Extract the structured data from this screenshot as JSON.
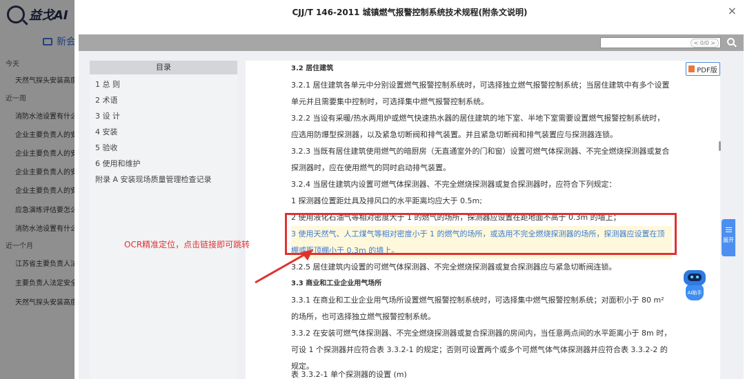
{
  "app": {
    "logo_text": "益戈AI",
    "new_chat_label": "新会",
    "groups": [
      {
        "label": "今天",
        "items": [
          "天然气探头安装高度"
        ]
      },
      {
        "label": "近一周",
        "items": [
          "消防水池设置有什么",
          "企业主要负责人的安",
          "企业主要负责人的安",
          "企业主要负责人的安",
          "企业主要负责人的安",
          "应急演练评估要怎么",
          "消防水池设置有什么"
        ]
      },
      {
        "label": "近一个月",
        "items": [
          "江苏省主要负责人法",
          "主要负责人法定安全",
          "天然气探头安装高度"
        ]
      }
    ]
  },
  "modal": {
    "title": "CJJ/T 146-2011 城镇燃气报警控制系统技术规程(附条文说明)",
    "close_label": "×"
  },
  "search": {
    "placeholder": "",
    "count": "< 0/0 >"
  },
  "toc": {
    "header": "目录",
    "items": [
      "1 总 则",
      "2 术语",
      "3 设 计",
      "4 安装",
      "5 验收",
      "6 使用和维护",
      "附录 A 安装现场质量管理检查记录"
    ]
  },
  "doc": {
    "pdf_label": "PDF版",
    "paragraphs": [
      {
        "text": "3.2 居住建筑",
        "style": "bold"
      },
      {
        "text": "3.2.1 居住建筑各单元中分别设置燃气报警控制系统时，可选择独立燃气报警控制系统；当居住建筑中有多个设置单元并且需要集中控制时，可选择集中燃气报警控制系统。",
        "style": "normal"
      },
      {
        "text": "3.2.2 当设有采暖/热水两用炉或燃气快速热水器的居住建筑的地下室、半地下室需要设置燃气报警控制系统时，应选用防爆型探测器，以及紧急切断阀和排气装置。并且紧急切断阀和排气装置应与探测器连锁。",
        "style": "normal"
      },
      {
        "text": "3.2.3 当既有居住建筑使用燃气的暗厨房（无直通室外的门和窗）设置可燃气体探测器、不完全燃烧探测器或复合探测器时，应在使用燃气的同时启动排气装置。",
        "style": "normal"
      },
      {
        "text": "3.2.4 当居住建筑内设置可燃气体探测器、不完全燃烧探测器或复合探测器时，应符合下列规定：",
        "style": "normal"
      },
      {
        "text": "1 探测器位置距灶具及排风口的水平距离均应大于 0.5m;",
        "style": "normal"
      },
      {
        "text": "2 使用液化石油气等相对密度大于 1 的燃气的场所，探测器应设置在距地面不高于 0.3m 的墙上；",
        "style": "normal"
      },
      {
        "text": "3 使用天然气、人工煤气等相对密度小于 1 的燃气的场所，或选用不完全燃烧探测器的场所，探测器应设置在顶棚或距顶棚小于 0.3m 的墙上。",
        "style": "highlight"
      },
      {
        "text": "3.2.5 居住建筑内设置的可燃气体探测器、不完全燃烧探测器或复合探测器应与紧急切断阀连锁。",
        "style": "normal"
      },
      {
        "text": "3.3 商业和工业企业用气场所",
        "style": "bold"
      },
      {
        "text": "3.3.1 在商业和工业企业用气场所设置燃气报警控制系统时，可选择集中燃气报警控制系统；对面积小于 80 m² 的场所，也可选择独立燃气报警控制系统。",
        "style": "normal"
      },
      {
        "text": "3.3.2 在安装可燃气体探测器、不完全燃烧探测器或复合探测器的房间内，当任意两点间的水平距离小于 8m 时，可设 1 个探测器并应符合表 3.3.2-1 的规定；否则可设置两个或多个可燃气体气体探测器并应符合表 3.3.2-2 的规定。",
        "style": "normal"
      },
      {
        "text": "表 3.3.2-1 单个探测器的设置 (m)",
        "style": "normal"
      }
    ]
  },
  "annotation": {
    "text": "OCR精准定位，点击链接即可跳转",
    "color": "#e03131"
  },
  "side_tab": {
    "label": "展开"
  },
  "ai_helper": {
    "label": "AI助手"
  }
}
